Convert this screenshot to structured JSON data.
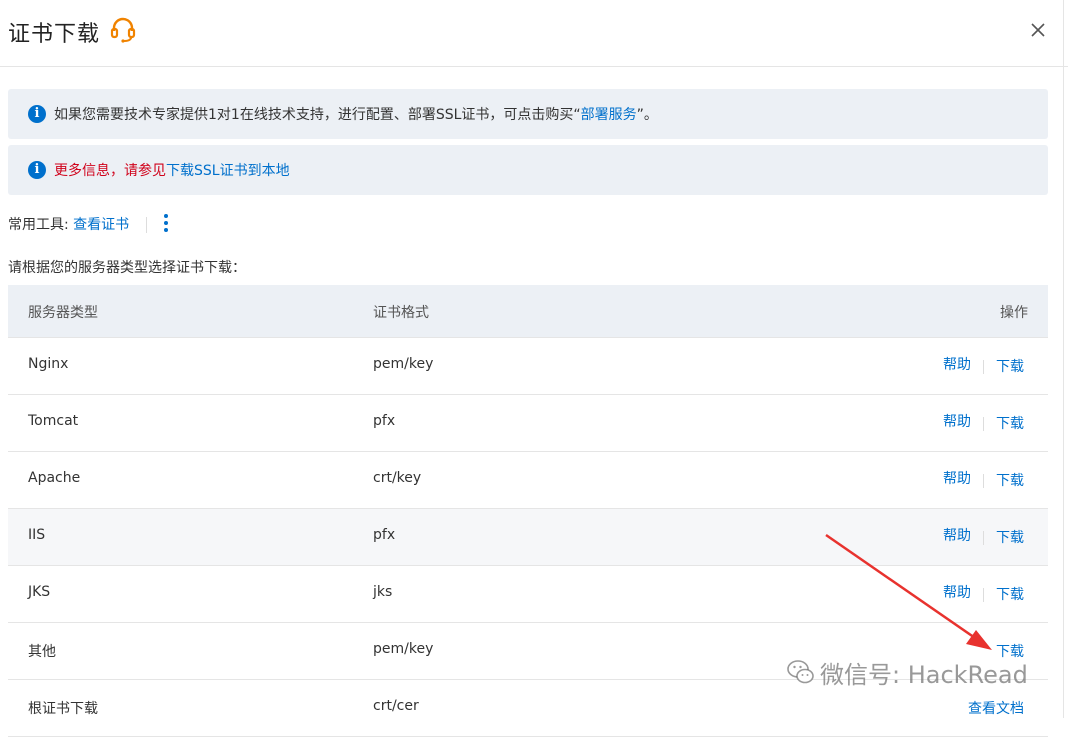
{
  "dialog": {
    "title": "证书下载",
    "close_icon": "close-icon",
    "support_icon": "headset-icon"
  },
  "notices": [
    {
      "icon": "info-icon",
      "text_before": "如果您需要技术专家提供1对1在线技术支持，进行配置、部署SSL证书，可点击购买“",
      "link": "部署服务",
      "text_after": "”。"
    },
    {
      "icon": "info-icon",
      "text_red": "更多信息，请参见",
      "link": "下载SSL证书到本地"
    }
  ],
  "tools": {
    "label": "常用工具:",
    "link": "查看证书",
    "more_icon": "more-vertical-icon"
  },
  "prompt": "请根据您的服务器类型选择证书下载：",
  "table": {
    "headers": [
      "服务器类型",
      "证书格式",
      "操作"
    ],
    "rows": [
      {
        "server": "Nginx",
        "format": "pem/key",
        "help": "帮助",
        "download": "下载"
      },
      {
        "server": "Tomcat",
        "format": "pfx",
        "help": "帮助",
        "download": "下载"
      },
      {
        "server": "Apache",
        "format": "crt/key",
        "help": "帮助",
        "download": "下载"
      },
      {
        "server": "IIS",
        "format": "pfx",
        "help": "帮助",
        "download": "下载"
      },
      {
        "server": "JKS",
        "format": "jks",
        "help": "帮助",
        "download": "下载"
      },
      {
        "server": "其他",
        "format": "pem/key",
        "download": "下载"
      },
      {
        "server": "根证书下载",
        "format": "crt/cer",
        "doc": "查看文档"
      }
    ]
  },
  "watermark": "微信号: HackRead",
  "colors": {
    "link": "#0070cc",
    "red": "#d0021b",
    "notice_bg": "#ecf0f5",
    "arrow": "#e8322e"
  }
}
